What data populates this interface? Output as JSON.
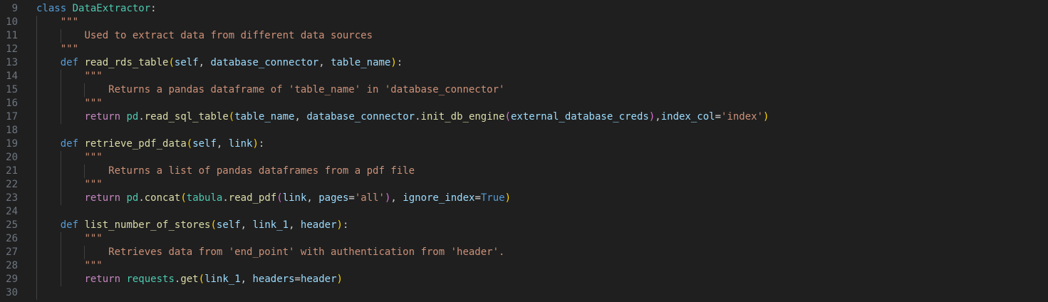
{
  "editor": {
    "theme_colors": {
      "background": "#1f1f1f",
      "line_number": "#6e7681",
      "keyword": "#569cd6",
      "class_name": "#4ec9b0",
      "function": "#dcdcaa",
      "parameter": "#9cdcfe",
      "string": "#ce9178",
      "control": "#c586c0",
      "bracket_1": "#ffd700",
      "bracket_2": "#da70d6",
      "default": "#cccccc"
    },
    "lines": [
      {
        "number": "9",
        "indent": 0,
        "tokens": [
          [
            "kw",
            "class"
          ],
          [
            "default",
            " "
          ],
          [
            "class",
            "DataExtractor"
          ],
          [
            "default",
            ":"
          ]
        ]
      },
      {
        "number": "10",
        "indent": 1,
        "tokens": [
          [
            "str",
            "\"\"\""
          ]
        ]
      },
      {
        "number": "11",
        "indent": 2,
        "tokens": [
          [
            "str",
            "Used to extract data from different data sources"
          ]
        ]
      },
      {
        "number": "12",
        "indent": 1,
        "tokens": [
          [
            "str",
            "\"\"\""
          ]
        ]
      },
      {
        "number": "13",
        "indent": 1,
        "tokens": [
          [
            "kw",
            "def"
          ],
          [
            "default",
            " "
          ],
          [
            "fn",
            "read_rds_table"
          ],
          [
            "p1",
            "("
          ],
          [
            "param",
            "self"
          ],
          [
            "default",
            ", "
          ],
          [
            "param",
            "database_connector"
          ],
          [
            "default",
            ", "
          ],
          [
            "param",
            "table_name"
          ],
          [
            "p1",
            ")"
          ],
          [
            "default",
            ":"
          ]
        ]
      },
      {
        "number": "14",
        "indent": 2,
        "tokens": [
          [
            "str",
            "\"\"\""
          ]
        ]
      },
      {
        "number": "15",
        "indent": 3,
        "tokens": [
          [
            "str",
            "Returns a pandas dataframe of 'table_name' in 'database_connector'"
          ]
        ]
      },
      {
        "number": "16",
        "indent": 2,
        "tokens": [
          [
            "str",
            "\"\"\""
          ]
        ]
      },
      {
        "number": "17",
        "indent": 2,
        "tokens": [
          [
            "ret",
            "return"
          ],
          [
            "default",
            " "
          ],
          [
            "class",
            "pd"
          ],
          [
            "default",
            "."
          ],
          [
            "fn",
            "read_sql_table"
          ],
          [
            "p1",
            "("
          ],
          [
            "param",
            "table_name"
          ],
          [
            "default",
            ", "
          ],
          [
            "param",
            "database_connector"
          ],
          [
            "default",
            "."
          ],
          [
            "fn",
            "init_db_engine"
          ],
          [
            "p2",
            "("
          ],
          [
            "param",
            "external_database_creds"
          ],
          [
            "p2",
            ")"
          ],
          [
            "default",
            ","
          ],
          [
            "param",
            "index_col"
          ],
          [
            "op",
            "="
          ],
          [
            "str",
            "'index'"
          ],
          [
            "p1",
            ")"
          ]
        ]
      },
      {
        "number": "18",
        "indent": 1,
        "tokens": []
      },
      {
        "number": "19",
        "indent": 1,
        "tokens": [
          [
            "kw",
            "def"
          ],
          [
            "default",
            " "
          ],
          [
            "fn",
            "retrieve_pdf_data"
          ],
          [
            "p1",
            "("
          ],
          [
            "param",
            "self"
          ],
          [
            "default",
            ", "
          ],
          [
            "param",
            "link"
          ],
          [
            "p1",
            ")"
          ],
          [
            "default",
            ":"
          ]
        ]
      },
      {
        "number": "20",
        "indent": 2,
        "tokens": [
          [
            "str",
            "\"\"\""
          ]
        ]
      },
      {
        "number": "21",
        "indent": 3,
        "tokens": [
          [
            "str",
            "Returns a list of pandas dataframes from a pdf file"
          ]
        ]
      },
      {
        "number": "22",
        "indent": 2,
        "tokens": [
          [
            "str",
            "\"\"\""
          ]
        ]
      },
      {
        "number": "23",
        "indent": 2,
        "tokens": [
          [
            "ret",
            "return"
          ],
          [
            "default",
            " "
          ],
          [
            "class",
            "pd"
          ],
          [
            "default",
            "."
          ],
          [
            "fn",
            "concat"
          ],
          [
            "p1",
            "("
          ],
          [
            "class",
            "tabula"
          ],
          [
            "default",
            "."
          ],
          [
            "fn",
            "read_pdf"
          ],
          [
            "p2",
            "("
          ],
          [
            "param",
            "link"
          ],
          [
            "default",
            ", "
          ],
          [
            "param",
            "pages"
          ],
          [
            "op",
            "="
          ],
          [
            "str",
            "'all'"
          ],
          [
            "p2",
            ")"
          ],
          [
            "default",
            ", "
          ],
          [
            "param",
            "ignore_index"
          ],
          [
            "op",
            "="
          ],
          [
            "kw",
            "True"
          ],
          [
            "p1",
            ")"
          ]
        ]
      },
      {
        "number": "24",
        "indent": 1,
        "tokens": []
      },
      {
        "number": "25",
        "indent": 1,
        "tokens": [
          [
            "kw",
            "def"
          ],
          [
            "default",
            " "
          ],
          [
            "fn",
            "list_number_of_stores"
          ],
          [
            "p1",
            "("
          ],
          [
            "param",
            "self"
          ],
          [
            "default",
            ", "
          ],
          [
            "param",
            "link_1"
          ],
          [
            "default",
            ", "
          ],
          [
            "param",
            "header"
          ],
          [
            "p1",
            ")"
          ],
          [
            "default",
            ":"
          ]
        ]
      },
      {
        "number": "26",
        "indent": 2,
        "tokens": [
          [
            "str",
            "\"\"\""
          ]
        ]
      },
      {
        "number": "27",
        "indent": 3,
        "tokens": [
          [
            "str",
            "Retrieves data from 'end_point' with authentication from 'header'."
          ]
        ]
      },
      {
        "number": "28",
        "indent": 2,
        "tokens": [
          [
            "str",
            "\"\"\""
          ]
        ]
      },
      {
        "number": "29",
        "indent": 2,
        "tokens": [
          [
            "ret",
            "return"
          ],
          [
            "default",
            " "
          ],
          [
            "class",
            "requests"
          ],
          [
            "default",
            "."
          ],
          [
            "fn",
            "get"
          ],
          [
            "p1",
            "("
          ],
          [
            "param",
            "link_1"
          ],
          [
            "default",
            ", "
          ],
          [
            "param",
            "headers"
          ],
          [
            "op",
            "="
          ],
          [
            "param",
            "header"
          ],
          [
            "p1",
            ")"
          ]
        ]
      },
      {
        "number": "30",
        "indent": 1,
        "tokens": []
      }
    ]
  }
}
